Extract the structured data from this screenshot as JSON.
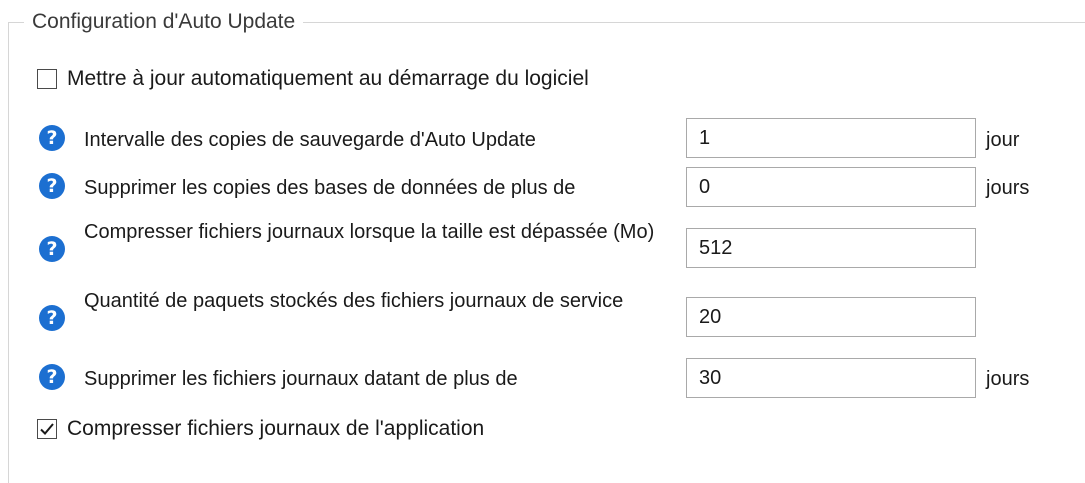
{
  "group": {
    "title": "Configuration d'Auto Update"
  },
  "auto_update_on_start": {
    "label": "Mettre à jour automatiquement au démarrage du logiciel",
    "checked": false
  },
  "settings": [
    {
      "label": "Intervalle des copies de sauvegarde d'Auto Update",
      "value": "1",
      "unit": "jour"
    },
    {
      "label": "Supprimer les copies des bases de données de plus de",
      "value": "0",
      "unit": "jours"
    },
    {
      "label": "Compresser fichiers journaux lorsque la taille est dépassée (Mo)",
      "value": "512",
      "unit": ""
    },
    {
      "label": "Quantité de paquets stockés des fichiers journaux de service",
      "value": "20",
      "unit": ""
    },
    {
      "label": "Supprimer les fichiers journaux datant de plus de",
      "value": "30",
      "unit": "jours"
    }
  ],
  "compress_app_logs": {
    "label": "Compresser fichiers journaux de l'application",
    "checked": true
  },
  "help_icon_glyph": "?",
  "colors": {
    "help_icon": "#1c6fd1",
    "border": "#a9a9a9"
  }
}
